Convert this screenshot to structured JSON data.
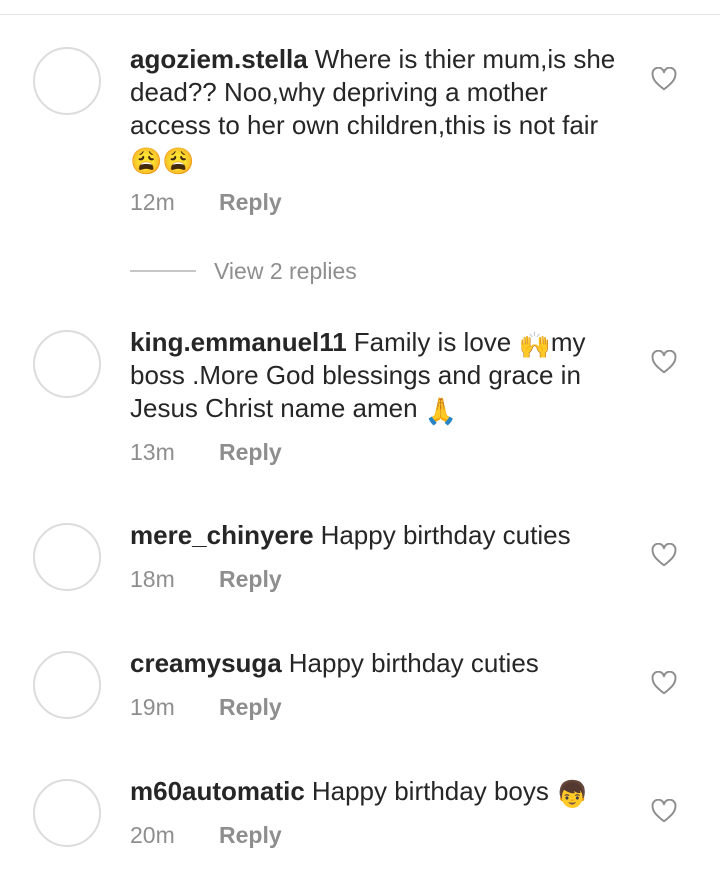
{
  "comments": [
    {
      "username": "agoziem.stella",
      "text": "Where is thier mum,is she dead?? Noo,why depriving a mother access to her own children,this is not fair",
      "emoji": "😩😩",
      "time": "12m",
      "reply_label": "Reply"
    },
    {
      "username": "king.emmanuel11",
      "text_part1": "Family is love ",
      "emoji1": "🙌",
      "text_part2": "my boss .More God blessings and grace in Jesus Christ name amen ",
      "emoji2": "🙏",
      "time": "13m",
      "reply_label": "Reply"
    },
    {
      "username": "mere_chinyere",
      "text": "Happy birthday cuties",
      "time": "18m",
      "reply_label": "Reply"
    },
    {
      "username": "creamysuga",
      "text": "Happy birthday cuties",
      "time": "19m",
      "reply_label": "Reply"
    },
    {
      "username": "m60automatic",
      "text": "Happy birthday boys ",
      "emoji": "👦",
      "time": "20m",
      "reply_label": "Reply"
    }
  ],
  "view_replies_label": "View 2 replies",
  "icons": {
    "like": "heart-outline-icon"
  },
  "colors": {
    "text": "#262626",
    "secondary": "#8e8e8e",
    "avatar_border": "#dcdcdc"
  }
}
